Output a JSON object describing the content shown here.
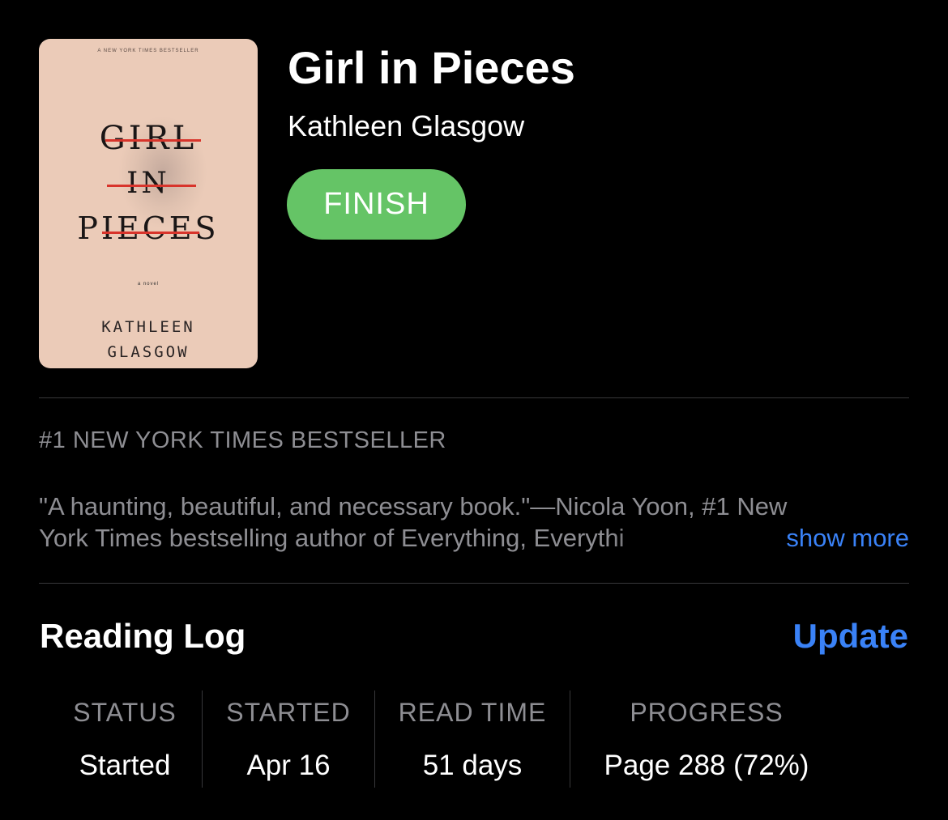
{
  "book": {
    "cover": {
      "top_line": "A NEW YORK TIMES BESTSELLER",
      "word1": "GIRL",
      "word2": "IN",
      "word3": "PIECES",
      "novel": "a novel",
      "author_line1": "KATHLEEN",
      "author_line2": "GLASGOW",
      "background": "#ebcbb8",
      "strike_color": "#d8342b"
    },
    "title": "Girl in Pieces",
    "author": "Kathleen Glasgow",
    "finish_label": "FINISH"
  },
  "description": {
    "tagline": "#1 NEW YORK TIMES BESTSELLER",
    "line1": "\"A haunting, beautiful, and necessary book.\"—Nicola Yoon, #1 New",
    "line2": "York Times bestselling author of Everything, Everythi",
    "show_more": "show more"
  },
  "reading_log": {
    "title": "Reading Log",
    "update_label": "Update",
    "stats": [
      {
        "label": "STATUS",
        "value": "Started"
      },
      {
        "label": "STARTED",
        "value": "Apr 16"
      },
      {
        "label": "READ TIME",
        "value": "51 days"
      },
      {
        "label": "PROGRESS",
        "value": "Page 288 (72%)"
      }
    ]
  },
  "colors": {
    "accent_blue": "#3a82f7",
    "finish_green": "#65c466",
    "secondary_text": "#8e8e93",
    "background": "#000000"
  }
}
